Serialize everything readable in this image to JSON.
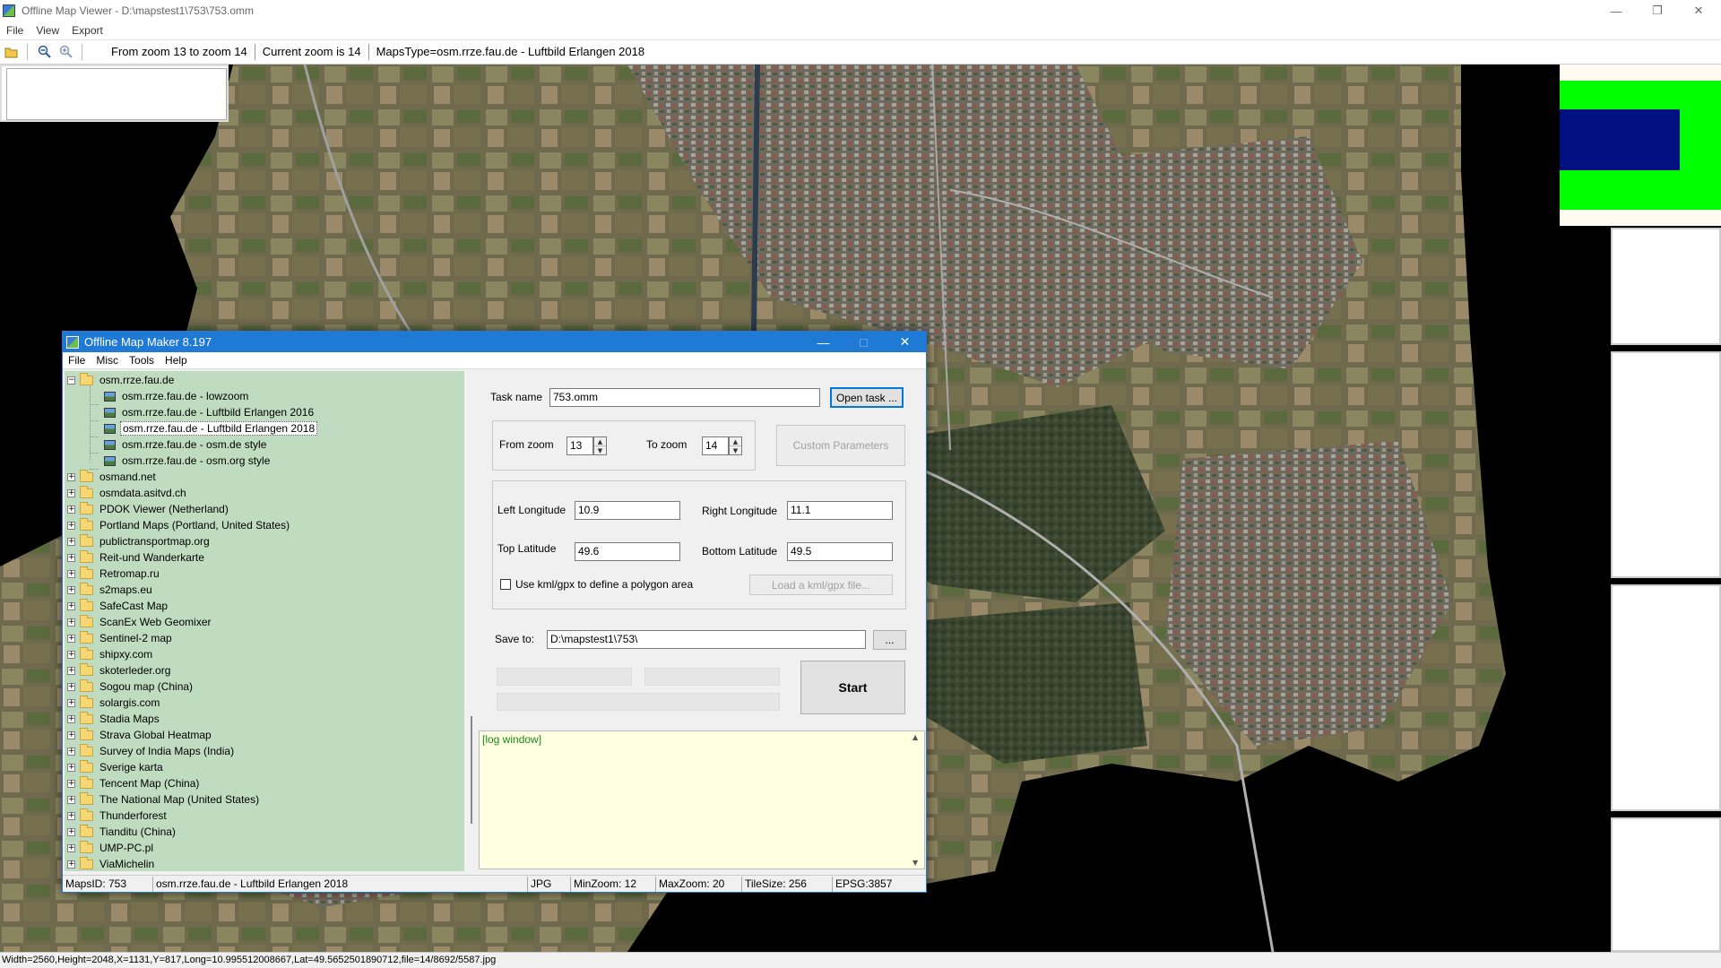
{
  "viewer": {
    "title": "Offline Map Viewer - D:\\mapstest1\\753\\753.omm",
    "menu": [
      "File",
      "View",
      "Export"
    ],
    "toolbar": {
      "zoom_range": "From zoom 13 to zoom 14",
      "current_zoom": "Current zoom is 14",
      "maps_type": "MapsType=osm.rrze.fau.de - Luftbild Erlangen 2018"
    },
    "status_bar": "Width=2560,Height=2048,X=1131,Y=817,Long=10.995512008667,Lat=49.5652501890712,file=14/8692/5587.jpg"
  },
  "omm": {
    "title": "Offline Map Maker 8.197",
    "menu": [
      "File",
      "Misc",
      "Tools",
      "Help"
    ],
    "tree": {
      "root": "osm.rrze.fau.de",
      "children": [
        {
          "label": "osm.rrze.fau.de - lowzoom",
          "selected": false
        },
        {
          "label": "osm.rrze.fau.de - Luftbild Erlangen 2016",
          "selected": false
        },
        {
          "label": "osm.rrze.fau.de - Luftbild Erlangen 2018",
          "selected": true
        },
        {
          "label": "osm.rrze.fau.de - osm.de style",
          "selected": false
        },
        {
          "label": "osm.rrze.fau.de - osm.org style",
          "selected": false
        }
      ],
      "folders": [
        "osmand.net",
        "osmdata.asitvd.ch",
        "PDOK Viewer (Netherland)",
        "Portland Maps (Portland, United States)",
        "publictransportmap.org",
        "Reit-und Wanderkarte",
        "Retromap.ru",
        "s2maps.eu",
        "SafeCast Map",
        "ScanEx Web Geomixer",
        "Sentinel-2 map",
        "shipxy.com",
        "skoterleder.org",
        "Sogou map (China)",
        "solargis.com",
        "Stadia Maps",
        "Strava Global Heatmap",
        "Survey of India Maps (India)",
        "Sverige karta",
        "Tencent Map (China)",
        "The National Map (United States)",
        "Thunderforest",
        "Tianditu (China)",
        "UMP-PC.pl",
        "ViaMichelin"
      ]
    },
    "form": {
      "task_name_label": "Task name",
      "task_name_value": "753.omm",
      "open_task_label": "Open task ...",
      "from_zoom_label": "From zoom",
      "from_zoom_value": "13",
      "to_zoom_label": "To zoom",
      "to_zoom_value": "14",
      "custom_params_label": "Custom Parameters",
      "left_long_label": "Left Longitude",
      "left_long_value": "10.9",
      "right_long_label": "Right Longitude",
      "right_long_value": "11.1",
      "top_lat_label": "Top Latitude",
      "top_lat_value": "49.6",
      "bottom_lat_label": "Bottom Latitude",
      "bottom_lat_value": "49.5",
      "kml_checkbox_label": "Use kml/gpx to define a polygon area",
      "kml_checked": false,
      "load_kml_label": "Load a kml/gpx file...",
      "save_to_label": "Save to:",
      "save_to_value": "D:\\mapstest1\\753\\",
      "browse_label": "...",
      "start_label": "Start",
      "log_text": "[log window]"
    },
    "status": {
      "maps_id": "MapsID: 753",
      "maps_name": "osm.rrze.fau.de - Luftbild Erlangen 2018",
      "format": "JPG",
      "min_zoom": "MinZoom: 12",
      "max_zoom": "MaxZoom: 20",
      "tile_size": "TileSize: 256",
      "epsg": "EPSG:3857"
    }
  },
  "colors": {
    "tree_bg": "#c0dcc0",
    "log_bg": "#ffffe1",
    "dialog_title": "#1f7ad6",
    "overview_green": "#00ff00",
    "overview_blue": "#001080"
  }
}
